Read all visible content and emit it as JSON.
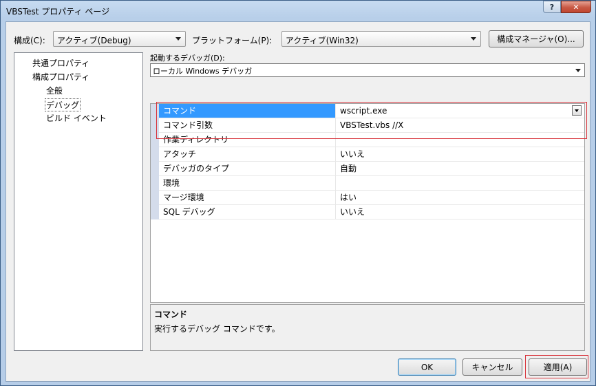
{
  "window": {
    "title": "VBSTest プロパティ ページ",
    "help_glyph": "?",
    "close_glyph": "✕"
  },
  "toolbar": {
    "config_label": "構成(C):",
    "config_value": "アクティブ(Debug)",
    "platform_label": "プラットフォーム(P):",
    "platform_value": "アクティブ(Win32)",
    "config_manager_button": "構成マネージャ(O)..."
  },
  "tree": {
    "items": [
      {
        "label": "共通プロパティ"
      },
      {
        "label": "構成プロパティ"
      },
      {
        "label": "全般"
      },
      {
        "label": "デバッグ"
      },
      {
        "label": "ビルド イベント"
      }
    ]
  },
  "debugger": {
    "label": "起動するデバッガ(D):",
    "value": "ローカル Windows デバッガ"
  },
  "properties": [
    {
      "name": "コマンド",
      "value": "wscript.exe"
    },
    {
      "name": "コマンド引数",
      "value": "VBSTest.vbs //X"
    },
    {
      "name": "作業ディレクトリ",
      "value": ""
    },
    {
      "name": "アタッチ",
      "value": "いいえ"
    },
    {
      "name": "デバッガのタイプ",
      "value": "自動"
    },
    {
      "name": "環境",
      "value": ""
    },
    {
      "name": "マージ環境",
      "value": "はい"
    },
    {
      "name": "SQL デバッグ",
      "value": "いいえ"
    }
  ],
  "description": {
    "title": "コマンド",
    "text": "実行するデバッグ コマンドです。"
  },
  "buttons": {
    "ok": "OK",
    "cancel": "キャンセル",
    "apply": "適用(A)"
  },
  "colors": {
    "selection": "#3399ff",
    "highlight_box": "#d8323a"
  }
}
